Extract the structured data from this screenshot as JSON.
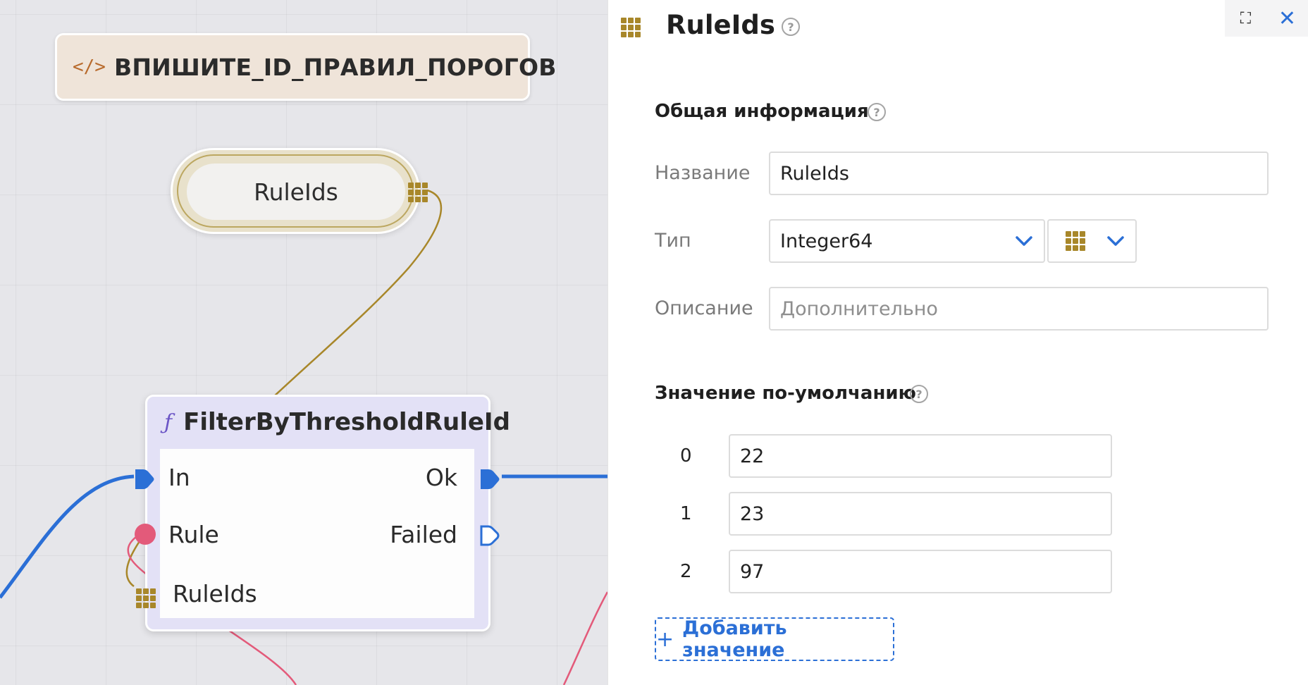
{
  "canvas": {
    "comment_node": {
      "icon": "code-icon",
      "text": "ВПИШИТЕ_ID_ПРАВИЛ_ПОРОГОВ"
    },
    "variable_node": {
      "label": "RuleIds",
      "icon": "array-grid-icon"
    },
    "function_node": {
      "icon": "function-icon",
      "name": "FilterByThresholdRuleId",
      "inputs": [
        {
          "label": "In",
          "port": "exec-filled"
        },
        {
          "label": "Rule",
          "port": "object-dot"
        },
        {
          "label": "RuleIds",
          "port": "array-grid"
        }
      ],
      "outputs": [
        {
          "label": "Ok",
          "port": "exec-filled"
        },
        {
          "label": "Failed",
          "port": "exec-outline"
        }
      ]
    },
    "colors": {
      "exec_wire": "#2b6fd6",
      "array_wire": "#a8872a",
      "object_wire": "#e35a7a"
    }
  },
  "panel": {
    "title": "RuleIds",
    "title_icon": "array-grid-icon",
    "controls": {
      "maximize_icon": "maximize-icon",
      "close_icon": "close-icon"
    },
    "general": {
      "title": "Общая информация",
      "name_label": "Название",
      "name_value": "RuleIds",
      "type_label": "Тип",
      "type_value": "Integer64",
      "container_icon": "array-grid-icon",
      "description_label": "Описание",
      "description_placeholder": "Дополнительно"
    },
    "defaults": {
      "title": "Значение по-умолчанию",
      "values": [
        {
          "index": "0",
          "value": "22"
        },
        {
          "index": "1",
          "value": "23"
        },
        {
          "index": "2",
          "value": "97"
        }
      ],
      "add_label": "Добавить значение"
    },
    "accent": "#2b6fd6"
  }
}
